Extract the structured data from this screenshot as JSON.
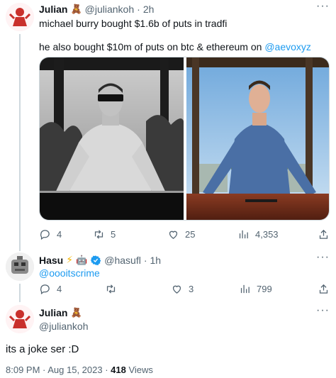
{
  "tweet1": {
    "name": "Julian",
    "handle": "@juliankoh",
    "time": "2h",
    "line1": "michael burry bought $1.6b of puts in tradfi",
    "line2_prefix": "he also bought $10m of puts on btc & ethereum on ",
    "mention": "@aevoxyz",
    "replies": "4",
    "retweets": "5",
    "likes": "25",
    "views": "4,353"
  },
  "tweet2": {
    "name": "Hasu",
    "handle": "@hasufl",
    "time": "1h",
    "mention": "@oooitscrime",
    "replies": "4",
    "likes": "3",
    "views": "799"
  },
  "main_tweet": {
    "name": "Julian",
    "handle": "@juliankoh",
    "text": "its a joke ser :D",
    "timestamp": "8:09 PM · Aug 15, 2023 · ",
    "views_count": "418",
    "views_label": " Views"
  },
  "colors": {
    "link": "#1d9bf0",
    "muted": "#536471",
    "verified": "#1d9bf0",
    "thread_line": "#cfd9de"
  },
  "icons": [
    "reply-icon",
    "retweet-icon",
    "like-icon",
    "views-icon",
    "share-icon",
    "more-icon",
    "verified-badge-icon"
  ]
}
